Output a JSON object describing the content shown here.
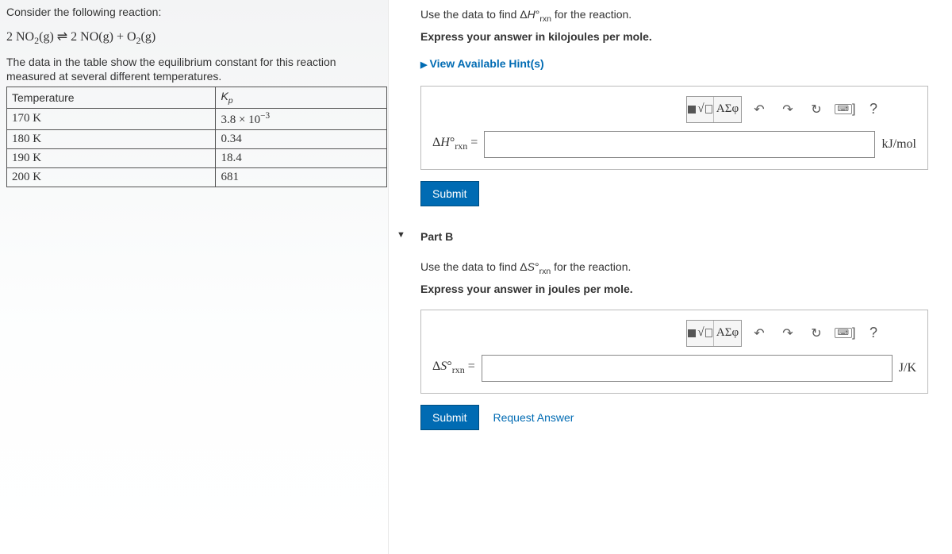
{
  "left": {
    "prompt": "Consider the following reaction:",
    "equation_html": "2 NO<sub>2</sub>(g) ⇌ 2 NO(g) + O<sub>2</sub>(g)",
    "description": "The data in the table show the equilibrium constant for this reaction measured at several different temperatures.",
    "table": {
      "headers": [
        "Temperature",
        "K_p"
      ],
      "rows": [
        [
          "170 K",
          "3.8 × 10⁻³"
        ],
        [
          "180 K",
          "0.34"
        ],
        [
          "190 K",
          "18.4"
        ],
        [
          "200 K",
          "681"
        ]
      ]
    }
  },
  "partA": {
    "instruction_line1": "Use the data to find ΔH°_rxn for the reaction.",
    "instruction_line2": "Express your answer in kilojoules per mole.",
    "hints_label": "View Available Hint(s)",
    "answer_label": "ΔH°_rxn =",
    "unit": "kJ/mol",
    "submit": "Submit"
  },
  "partB": {
    "title": "Part B",
    "instruction_line1": "Use the data to find ΔS°_rxn for the reaction.",
    "instruction_line2": "Express your answer in joules per mole.",
    "answer_label": "ΔS°_rxn =",
    "unit": "J/K",
    "submit": "Submit",
    "request": "Request Answer"
  },
  "toolbar": {
    "templates": "■√x",
    "greek": "ΑΣφ",
    "help": "?"
  }
}
